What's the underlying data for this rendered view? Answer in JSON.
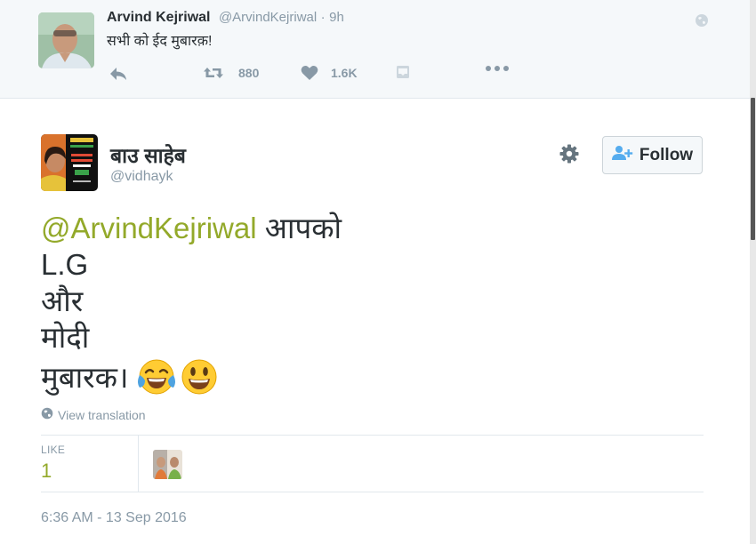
{
  "parent_tweet": {
    "name": "Arvind Kejriwal",
    "handle": "@ArvindKejriwal",
    "dot": "·",
    "time": "9h",
    "text": "सभी को ईद मुबारक़!",
    "retweets": "880",
    "likes": "1.6K",
    "icons": [
      "reply-icon",
      "retweet-icon",
      "heart-icon",
      "direct-message-icon",
      "more-icon",
      "globe-icon"
    ]
  },
  "main_tweet": {
    "name": "बाउ साहेब",
    "handle": "@vidhayk",
    "follow_label": "Follow",
    "mention": "@ArvindKejriwal",
    "line1_rest": " आपको",
    "line2": "L.G",
    "line3": "और",
    "line4": "मोदी",
    "line5": "मुबारक।",
    "emojis": [
      "tears-of-joy-emoji",
      "smiling-face-emoji"
    ],
    "translate_label": "View translation",
    "likes_label": "LIKE",
    "likes_count": "1",
    "timestamp": "6:36 AM - 13 Sep 2016"
  },
  "colors": {
    "accent": "#93a92a",
    "muted": "#8899a6",
    "text": "#292f33",
    "follow_icon": "#55acee"
  }
}
